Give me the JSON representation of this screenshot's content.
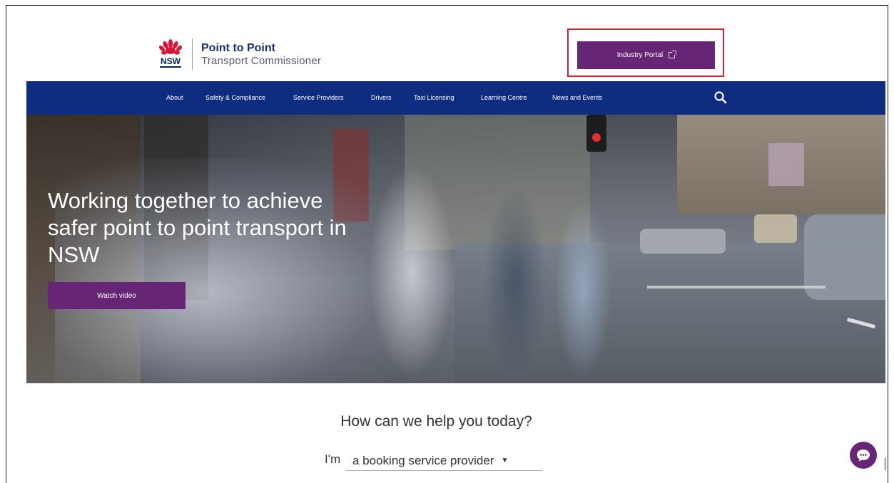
{
  "brand": {
    "nsw_logo_text": "NSW",
    "title": "Point to Point",
    "subtitle": "Transport Commissioner"
  },
  "header": {
    "portal_button_label": "Industry Portal"
  },
  "nav": {
    "items": [
      "About",
      "Safety & Compliance",
      "Service Providers",
      "Drivers",
      "Taxi Licensing",
      "Learning Centre",
      "News and Events"
    ]
  },
  "hero": {
    "heading": "Working together to achieve safer point to point transport in NSW",
    "button_label": "Watch video"
  },
  "help": {
    "title": "How can we help you today?",
    "prefix": "I'm",
    "selected_role": "a booking service provider"
  },
  "colors": {
    "nav_blue": "#0f2d80",
    "brand_purple": "#662675",
    "highlight_red": "#d01f2f",
    "nsw_red": "#d7153a",
    "nsw_navy": "#002664"
  },
  "icons": {
    "external": "external-link-icon",
    "search": "search-icon",
    "chat": "chat-icon",
    "dropdown": "caret-down-icon"
  }
}
